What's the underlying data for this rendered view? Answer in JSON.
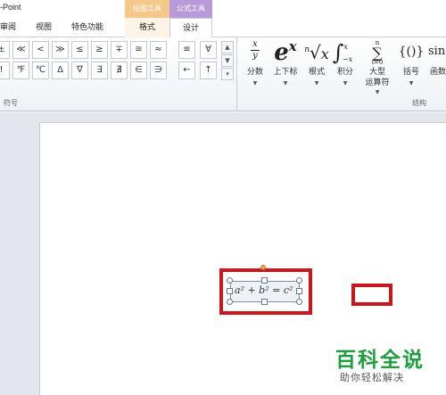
{
  "app": {
    "title": "-Point"
  },
  "context_tabs": {
    "left": "绘图工具",
    "right": "公式工具"
  },
  "tabs": [
    "审阅",
    "视图",
    "特色功能",
    "格式",
    "设计"
  ],
  "symbols": {
    "row1": [
      "±",
      "≪",
      "<",
      "≫",
      "≤",
      "≥",
      "∓",
      "≅",
      "≈",
      "≡",
      "∀"
    ],
    "row2": [
      "!",
      "℉",
      "℃",
      "Δ",
      "∇",
      "∃",
      "∄",
      "∈",
      "∋",
      "←",
      "↑"
    ],
    "group_label": "符号"
  },
  "structures": {
    "group_label": "结构",
    "tools": [
      {
        "glyph": "x/y",
        "label": "分数"
      },
      {
        "glyph": "eˣ",
        "label": "上下标"
      },
      {
        "glyph": "ⁿ√x",
        "label": "根式"
      },
      {
        "glyph": "∫",
        "label": "积分"
      },
      {
        "glyph": "∑",
        "label": "大型",
        "label2": "运算符"
      },
      {
        "glyph": "{()}",
        "label": "括号"
      },
      {
        "glyph": "sin",
        "label": "函数"
      }
    ]
  },
  "equation": {
    "text": "a² + b² = c²"
  },
  "watermark": {
    "title": "百科全说",
    "subtitle": "助你轻松解决"
  }
}
